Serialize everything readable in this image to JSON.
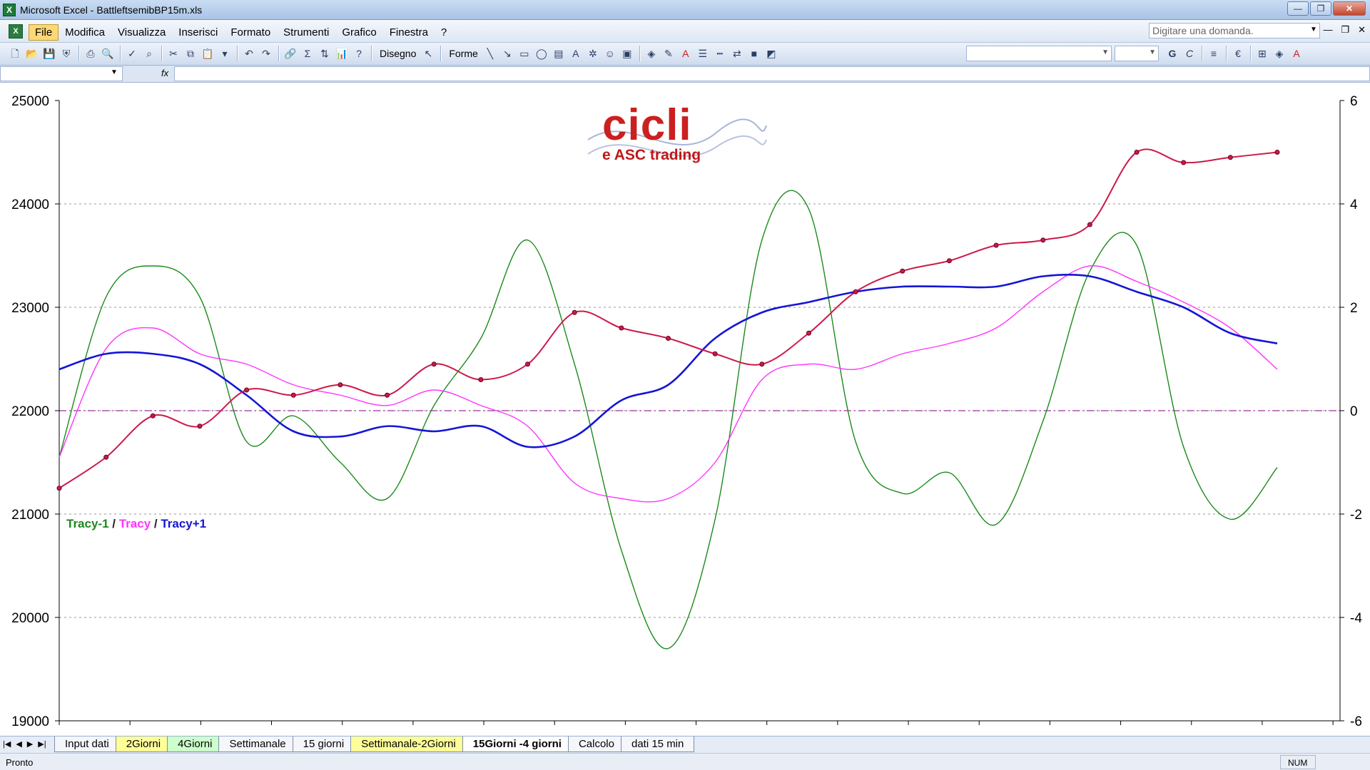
{
  "window": {
    "title": "Microsoft Excel - BattleftsemibBP15m.xls",
    "app_icon": "excel-icon"
  },
  "menu": {
    "items": [
      "File",
      "Modifica",
      "Visualizza",
      "Inserisci",
      "Formato",
      "Strumenti",
      "Grafico",
      "Finestra",
      "?"
    ],
    "ask_placeholder": "Digitare una domanda."
  },
  "toolbar": {
    "drawing_label": "Disegno",
    "shapes_label": "Forme",
    "bold": "G",
    "italic": "C"
  },
  "sheet_tabs": [
    {
      "label": "Input dati",
      "color": "#f4f6fa"
    },
    {
      "label": "2Giorni",
      "color": "#ffff99"
    },
    {
      "label": "4Giorni",
      "color": "#ccffcc"
    },
    {
      "label": "Settimanale",
      "color": "#f4f6fa"
    },
    {
      "label": "15 giorni",
      "color": "#f4f6fa"
    },
    {
      "label": "Settimanale-2Giorni",
      "color": "#ffff99"
    },
    {
      "label": "15Giorni -4 giorni",
      "color": "#ffffff",
      "active": true
    },
    {
      "label": "Calcolo",
      "color": "#f4f6fa"
    },
    {
      "label": "dati 15 min",
      "color": "#f4f6fa"
    }
  ],
  "status": {
    "text": "Pronto",
    "num": "NUM"
  },
  "logo": {
    "word": "cicli",
    "sub": "e ASC trading"
  },
  "legend": {
    "s1": "Tracy-1",
    "s2": "Tracy",
    "s3": "Tracy+1",
    "sep": " / "
  },
  "chart_data": {
    "type": "line",
    "y_left": {
      "ylim": [
        19000,
        25000
      ],
      "ticks": [
        "25000",
        "24000",
        "23000",
        "22000",
        "21000",
        "20000",
        "19000"
      ]
    },
    "y_right": {
      "ylim": [
        -6,
        6
      ],
      "ticks": [
        "6",
        "4",
        "2",
        "0",
        "-2",
        "-4",
        "-6"
      ]
    },
    "x": [
      0,
      5,
      10,
      15,
      20,
      25,
      30,
      35,
      40,
      45,
      50,
      55,
      60,
      65,
      70,
      75,
      80,
      85,
      90,
      95,
      100
    ],
    "series": [
      {
        "name": "Tracy-1",
        "axis": "right",
        "color": "#1b8a1b",
        "values": [
          -0.9,
          2.2,
          2.8,
          2.2,
          -0.6,
          -0.1,
          -1.0,
          -1.7,
          0.1,
          1.4,
          3.3,
          0.9,
          -2.7,
          -4.6,
          -2.1,
          3.3,
          3.9,
          -0.6,
          -1.6,
          -1.2,
          -2.2,
          -0.2,
          2.7,
          3.2,
          -0.7,
          -2.1,
          -1.1
        ]
      },
      {
        "name": "Tracy",
        "axis": "right",
        "color": "#ff33ff",
        "values": [
          -0.9,
          1.2,
          1.6,
          1.1,
          0.9,
          0.5,
          0.3,
          0.1,
          0.4,
          0.1,
          -0.3,
          -1.4,
          -1.7,
          -1.7,
          -1.0,
          0.6,
          0.9,
          0.8,
          1.1,
          1.3,
          1.6,
          2.3,
          2.8,
          2.5,
          2.1,
          1.6,
          0.8
        ]
      },
      {
        "name": "Tracy+1",
        "axis": "right",
        "color": "#1515d6",
        "values": [
          0.8,
          1.1,
          1.1,
          0.9,
          0.3,
          -0.4,
          -0.5,
          -0.3,
          -0.4,
          -0.3,
          -0.7,
          -0.5,
          0.2,
          0.5,
          1.4,
          1.9,
          2.1,
          2.3,
          2.4,
          2.4,
          2.4,
          2.6,
          2.6,
          2.3,
          2.0,
          1.5,
          1.3
        ]
      },
      {
        "name": "Price",
        "axis": "left",
        "color": "#cc1a4a",
        "values": [
          21250,
          21550,
          21950,
          21850,
          22200,
          22150,
          22250,
          22150,
          22450,
          22300,
          22450,
          22950,
          22800,
          22700,
          22550,
          22450,
          22750,
          23150,
          23350,
          23450,
          23600,
          23650,
          23800,
          24500,
          24400,
          24450,
          24500
        ]
      }
    ]
  }
}
